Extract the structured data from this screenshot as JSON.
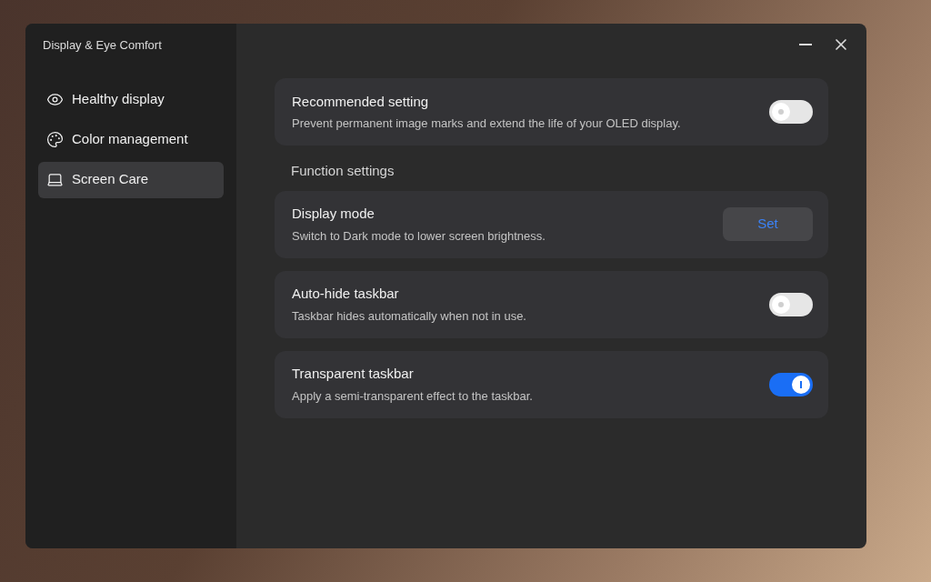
{
  "window": {
    "title": "Display & Eye Comfort"
  },
  "sidebar": {
    "items": [
      {
        "label": "Healthy display",
        "selected": false
      },
      {
        "label": "Color management",
        "selected": false
      },
      {
        "label": "Screen Care",
        "selected": true
      }
    ]
  },
  "recommended": {
    "title": "Recommended setting",
    "description": "Prevent permanent image marks and extend the life of your OLED display.",
    "on": false
  },
  "section_title": "Function settings",
  "settings": [
    {
      "kind": "button",
      "title": "Display mode",
      "description": "Switch to Dark mode to lower screen brightness.",
      "button": "Set"
    },
    {
      "kind": "toggle",
      "title": "Auto-hide taskbar",
      "description": "Taskbar hides automatically when not in use.",
      "on": false
    },
    {
      "kind": "toggle",
      "title": "Transparent taskbar",
      "description": "Apply a semi-transparent effect to the taskbar.",
      "on": true
    }
  ]
}
